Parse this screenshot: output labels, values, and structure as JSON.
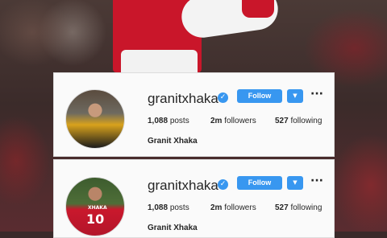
{
  "profiles": [
    {
      "username": "granitxhaka",
      "follow_label": "Follow",
      "posts_count": "1,088",
      "posts_label": "posts",
      "followers_count": "2m",
      "followers_label": "followers",
      "following_count": "527",
      "following_label": "following",
      "full_name": "Granit Xhaka"
    },
    {
      "username": "granitxhaka",
      "follow_label": "Follow",
      "posts_count": "1,088",
      "posts_label": "posts",
      "followers_count": "2m",
      "followers_label": "followers",
      "following_count": "527",
      "following_label": "following",
      "full_name": "Granit Xhaka",
      "jersey_number": "10",
      "jersey_name": "XHAKA"
    }
  ],
  "icons": {
    "verified": "verified-badge-icon",
    "dropdown": "chevron-down-icon",
    "more": "more-options-icon"
  },
  "colors": {
    "accent": "#3897f0",
    "card_bg": "#fafafa",
    "text": "#262626"
  }
}
